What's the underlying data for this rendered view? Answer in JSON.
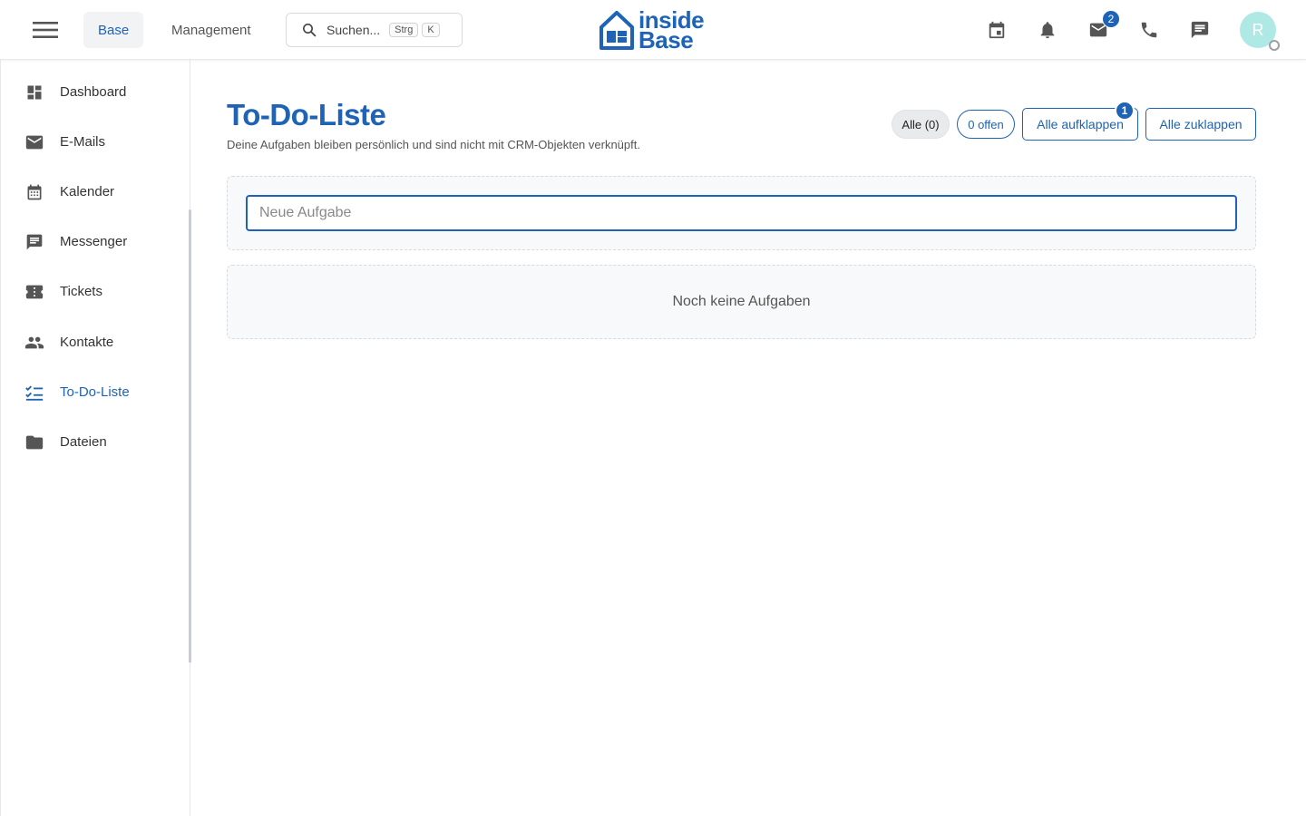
{
  "header": {
    "tabs": [
      {
        "label": "Base",
        "active": true
      },
      {
        "label": "Management",
        "active": false
      }
    ],
    "search": {
      "placeholder": "Suchen...",
      "shortcut_keys": [
        "Strg",
        "K"
      ]
    },
    "logo": {
      "line1": "inside",
      "line2": "Base"
    },
    "icons": [
      {
        "name": "calendar-icon"
      },
      {
        "name": "bell-icon"
      },
      {
        "name": "mail-icon",
        "badge": "2"
      },
      {
        "name": "phone-icon"
      },
      {
        "name": "chat-icon"
      }
    ],
    "avatar": {
      "initial": "R",
      "color": "#aee9e6"
    }
  },
  "sidebar": {
    "items": [
      {
        "label": "Dashboard",
        "icon": "dashboard-icon"
      },
      {
        "label": "E-Mails",
        "icon": "mail-icon"
      },
      {
        "label": "Kalender",
        "icon": "calendar-icon"
      },
      {
        "label": "Messenger",
        "icon": "chat-icon"
      },
      {
        "label": "Tickets",
        "icon": "ticket-icon"
      },
      {
        "label": "Kontakte",
        "icon": "people-icon"
      },
      {
        "label": "To-Do-Liste",
        "icon": "checklist-icon",
        "active": true
      },
      {
        "label": "Dateien",
        "icon": "folder-icon"
      }
    ]
  },
  "main": {
    "title": "To-Do-Liste",
    "subtitle": "Deine Aufgaben bleiben persönlich und sind nicht mit CRM-Objekten verknüpft.",
    "filters": {
      "all": "Alle (0)",
      "open": "0 offen"
    },
    "buttons": {
      "expand": "Alle aufklappen",
      "expand_badge": "1",
      "collapse": "Alle zuklappen"
    },
    "new_task_placeholder": "Neue Aufgabe",
    "empty_message": "Noch keine Aufgaben"
  },
  "colors": {
    "accent": "#1e63b6",
    "text": "#333333",
    "muted": "#555555"
  }
}
